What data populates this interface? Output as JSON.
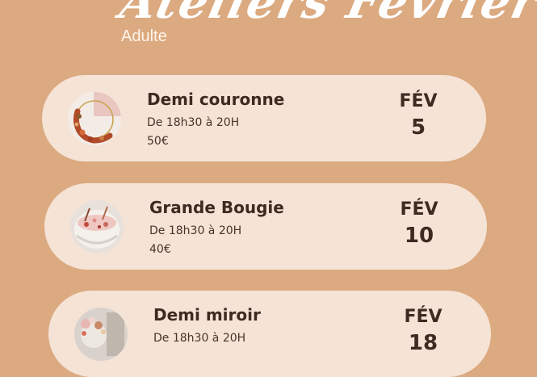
{
  "header": {
    "title": "Ateliers Février",
    "audience": "Adulte"
  },
  "workshops": [
    {
      "name": "Demi couronne",
      "time": "De 18h30 à 20H",
      "price": "50€",
      "month": "FÉV",
      "day": "5",
      "image": "dried-flower-half-wreath"
    },
    {
      "name": "Grande Bougie",
      "time": "De 18h30 à 20H",
      "price": "40€",
      "month": "FÉV",
      "day": "10",
      "image": "large-candle-with-dried-flowers"
    },
    {
      "name": "Demi miroir",
      "time": "De 18h30 à 20H",
      "price": "",
      "month": "FÉV",
      "day": "18",
      "image": "dried-flower-half-mirror"
    }
  ],
  "colors": {
    "background": "#dcaa80",
    "card": "#f5e3d6",
    "text": "#3f2a22",
    "title": "#ffffff"
  }
}
